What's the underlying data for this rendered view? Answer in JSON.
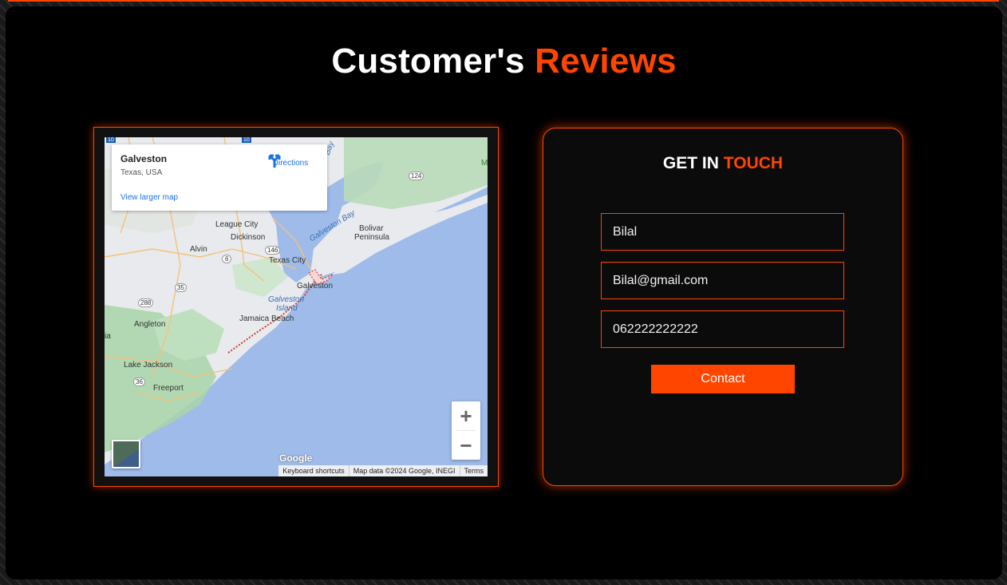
{
  "heading": {
    "part1": "Customer's",
    "part2": "Reviews"
  },
  "colors": {
    "accent": "#ff4500",
    "panel": "#000000",
    "card": "#0c0b0b"
  },
  "map": {
    "place_title": "Galveston",
    "place_subtitle": "Texas, USA",
    "view_larger": "View larger map",
    "directions": "Directions",
    "zoom_in": "+",
    "zoom_out": "−",
    "logo": "Google",
    "attribution": [
      "Keyboard shortcuts",
      "Map data ©2024 Google, INEGI",
      "Terms"
    ],
    "labels": {
      "league_city": "League City",
      "dickinson": "Dickinson",
      "alvin": "Alvin",
      "texas_city": "Texas City",
      "bolivar": "Bolivar",
      "peninsula": "Peninsula",
      "galveston_bay": "Galveston Bay",
      "galveston": "Galveston",
      "galveston_island_1": "Galveston",
      "galveston_island_2": "Island",
      "jamaica_beach": "Jamaica Beach",
      "angleton": "Angleton",
      "lake_jackson": "Lake Jackson",
      "freeport": "Freeport",
      "bay_side": "Bay",
      "ia": "ia",
      "m_edge": "M",
      "r124": "124",
      "r146": "146",
      "r6": "6",
      "r35": "35",
      "r288": "288",
      "r36": "36",
      "r10a": "10",
      "r10b": "10"
    }
  },
  "contact": {
    "title_part1": "GET IN",
    "title_part2": "TOUCH",
    "name_value": "Bilal",
    "email_value": "Bilal@gmail.com",
    "phone_value": "062222222222",
    "button": "Contact"
  }
}
